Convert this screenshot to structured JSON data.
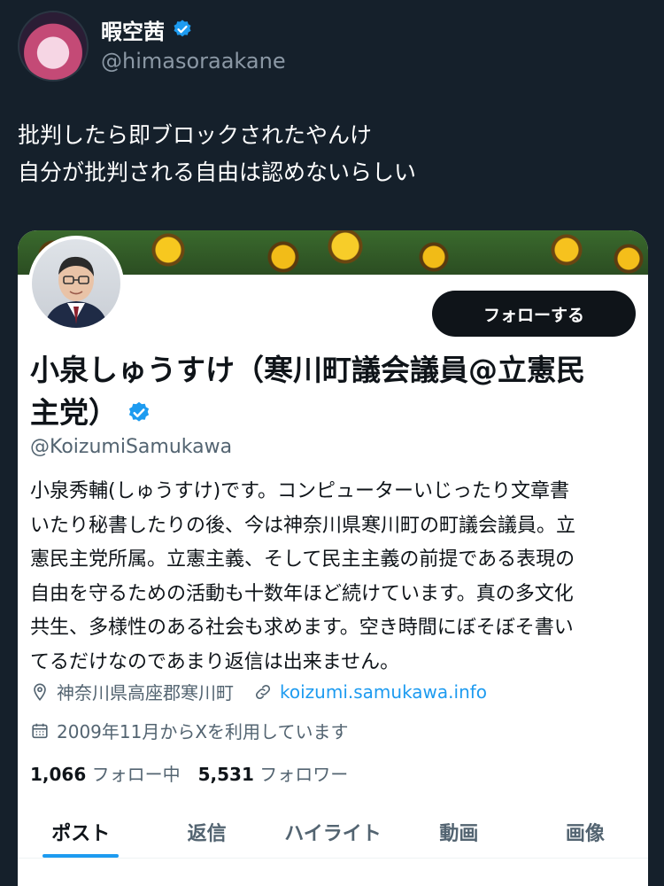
{
  "post": {
    "display_name": "暇空茜",
    "handle": "@himasoraakane",
    "text_lines": [
      "批判したら即ブロックされたやんけ",
      "自分が批判される自由は認めないらしい"
    ]
  },
  "profile_card": {
    "follow_button": "フォローする",
    "name_lines": [
      "小泉しゅうすけ（寒川町議会議員@立憲民",
      "主党）"
    ],
    "handle": "@KoizumiSamukawa",
    "bio_lines": [
      "小泉秀輔(しゅうすけ)です。コンピューターいじったり文章書",
      "いたり秘書したりの後、今は神奈川県寒川町の町議会議員。立",
      "憲民主党所属。立憲主義、そして民主主義の前提である表現の",
      "自由を守るための活動も十数年ほど続けています。真の多文化",
      "共生、多様性のある社会も求めます。空き時間にぼそぼそ書い",
      "てるだけなのであまり返信は出来ません。"
    ],
    "location": "神奈川県高座郡寒川町",
    "link": "koizumi.samukawa.info",
    "joined": "2009年11月からXを利用しています",
    "following_count": "1,066",
    "following_label": "フォロー中",
    "followers_count": "5,531",
    "followers_label": "フォロワー",
    "tabs": [
      "ポスト",
      "返信",
      "ハイライト",
      "動画",
      "画像"
    ]
  },
  "colors": {
    "background": "#15202b",
    "accent": "#1d9bf0",
    "verified": "#1d9bf0"
  }
}
